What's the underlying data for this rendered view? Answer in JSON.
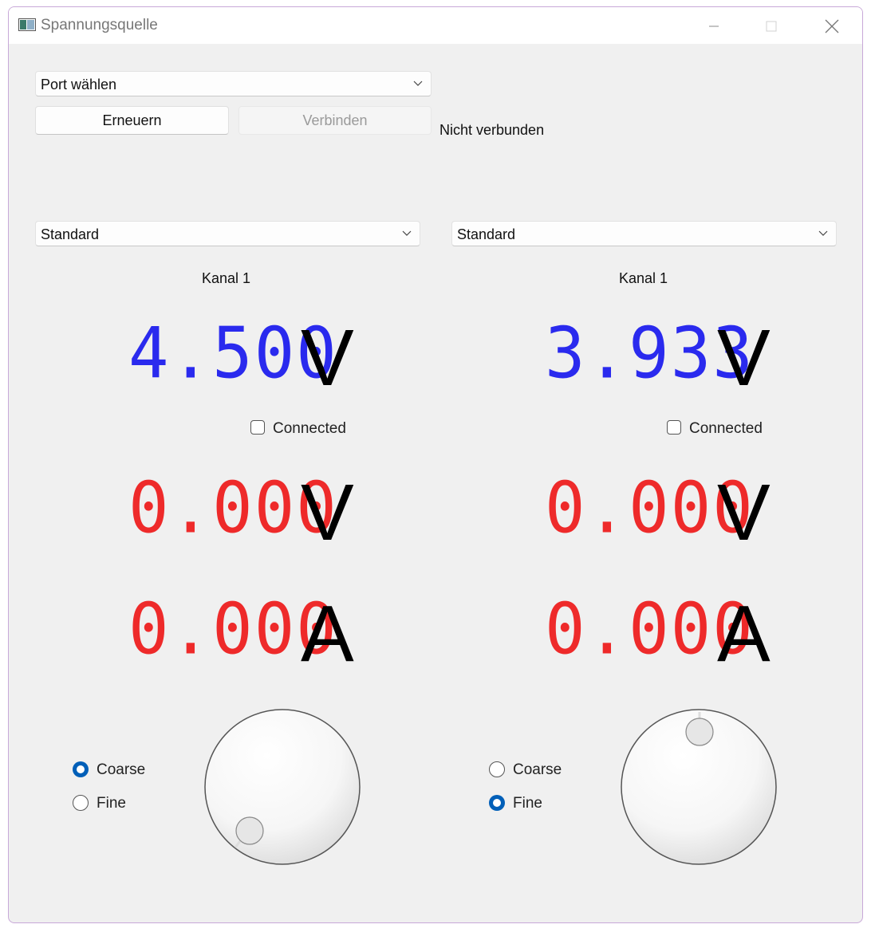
{
  "window": {
    "title": "Spannungsquelle"
  },
  "connection": {
    "port_placeholder": "Port wählen",
    "refresh_label": "Erneuern",
    "connect_label": "Verbinden",
    "status": "Nicht verbunden"
  },
  "channels": [
    {
      "mode": "Standard",
      "name": "Kanal 1",
      "set_voltage": "4.500",
      "set_voltage_unit": "V",
      "connected_label": "Connected",
      "connected": false,
      "measured_voltage": "0.000",
      "measured_voltage_unit": "V",
      "measured_current": "0.000",
      "measured_current_unit": "A",
      "coarse_label": "Coarse",
      "fine_label": "Fine",
      "step_mode": "Coarse"
    },
    {
      "mode": "Standard",
      "name": "Kanal 1",
      "set_voltage": "3.933",
      "set_voltage_unit": "V",
      "connected_label": "Connected",
      "connected": false,
      "measured_voltage": "0.000",
      "measured_voltage_unit": "V",
      "measured_current": "0.000",
      "measured_current_unit": "A",
      "coarse_label": "Coarse",
      "fine_label": "Fine",
      "step_mode": "Fine"
    }
  ],
  "colors": {
    "set_value": "#2a2aee",
    "measured_value": "#ee2a2a",
    "accent": "#005fb8"
  }
}
